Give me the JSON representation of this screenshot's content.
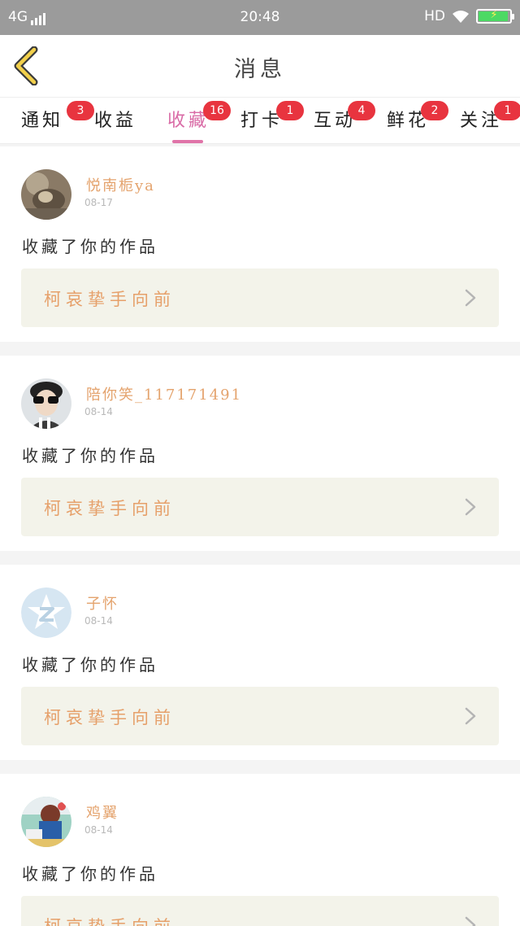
{
  "status": {
    "network": "4G",
    "time": "20:48",
    "hd": "HD"
  },
  "header": {
    "title": "消息",
    "back_icon": "chevron-left-icon",
    "accent": "#f2d04b"
  },
  "tabs": [
    {
      "label": "通知",
      "badge": "3"
    },
    {
      "label": "收益",
      "badge": ""
    },
    {
      "label": "收藏",
      "badge": "16",
      "active": true
    },
    {
      "label": "打卡",
      "badge": "1"
    },
    {
      "label": "互动",
      "badge": "4"
    },
    {
      "label": "鲜花",
      "badge": "2"
    },
    {
      "label": "关注",
      "badge": "1"
    }
  ],
  "messages": [
    {
      "user": "悦南栀ya",
      "date": "08-17",
      "action": "收藏了你的作品",
      "work_title": "柯哀挚手向前"
    },
    {
      "user": "陪你笑_117171491",
      "date": "08-14",
      "action": "收藏了你的作品",
      "work_title": "柯哀挚手向前"
    },
    {
      "user": "子怀",
      "date": "08-14",
      "action": "收藏了你的作品",
      "work_title": "柯哀挚手向前"
    },
    {
      "user": "鸡翼",
      "date": "08-14",
      "action": "收藏了你的作品",
      "work_title": "柯哀挚手向前"
    }
  ],
  "colors": {
    "active_tab": "#d96ba6",
    "badge": "#e8343f",
    "username": "#e4a36d",
    "work_card_bg": "#f3f3ea"
  }
}
